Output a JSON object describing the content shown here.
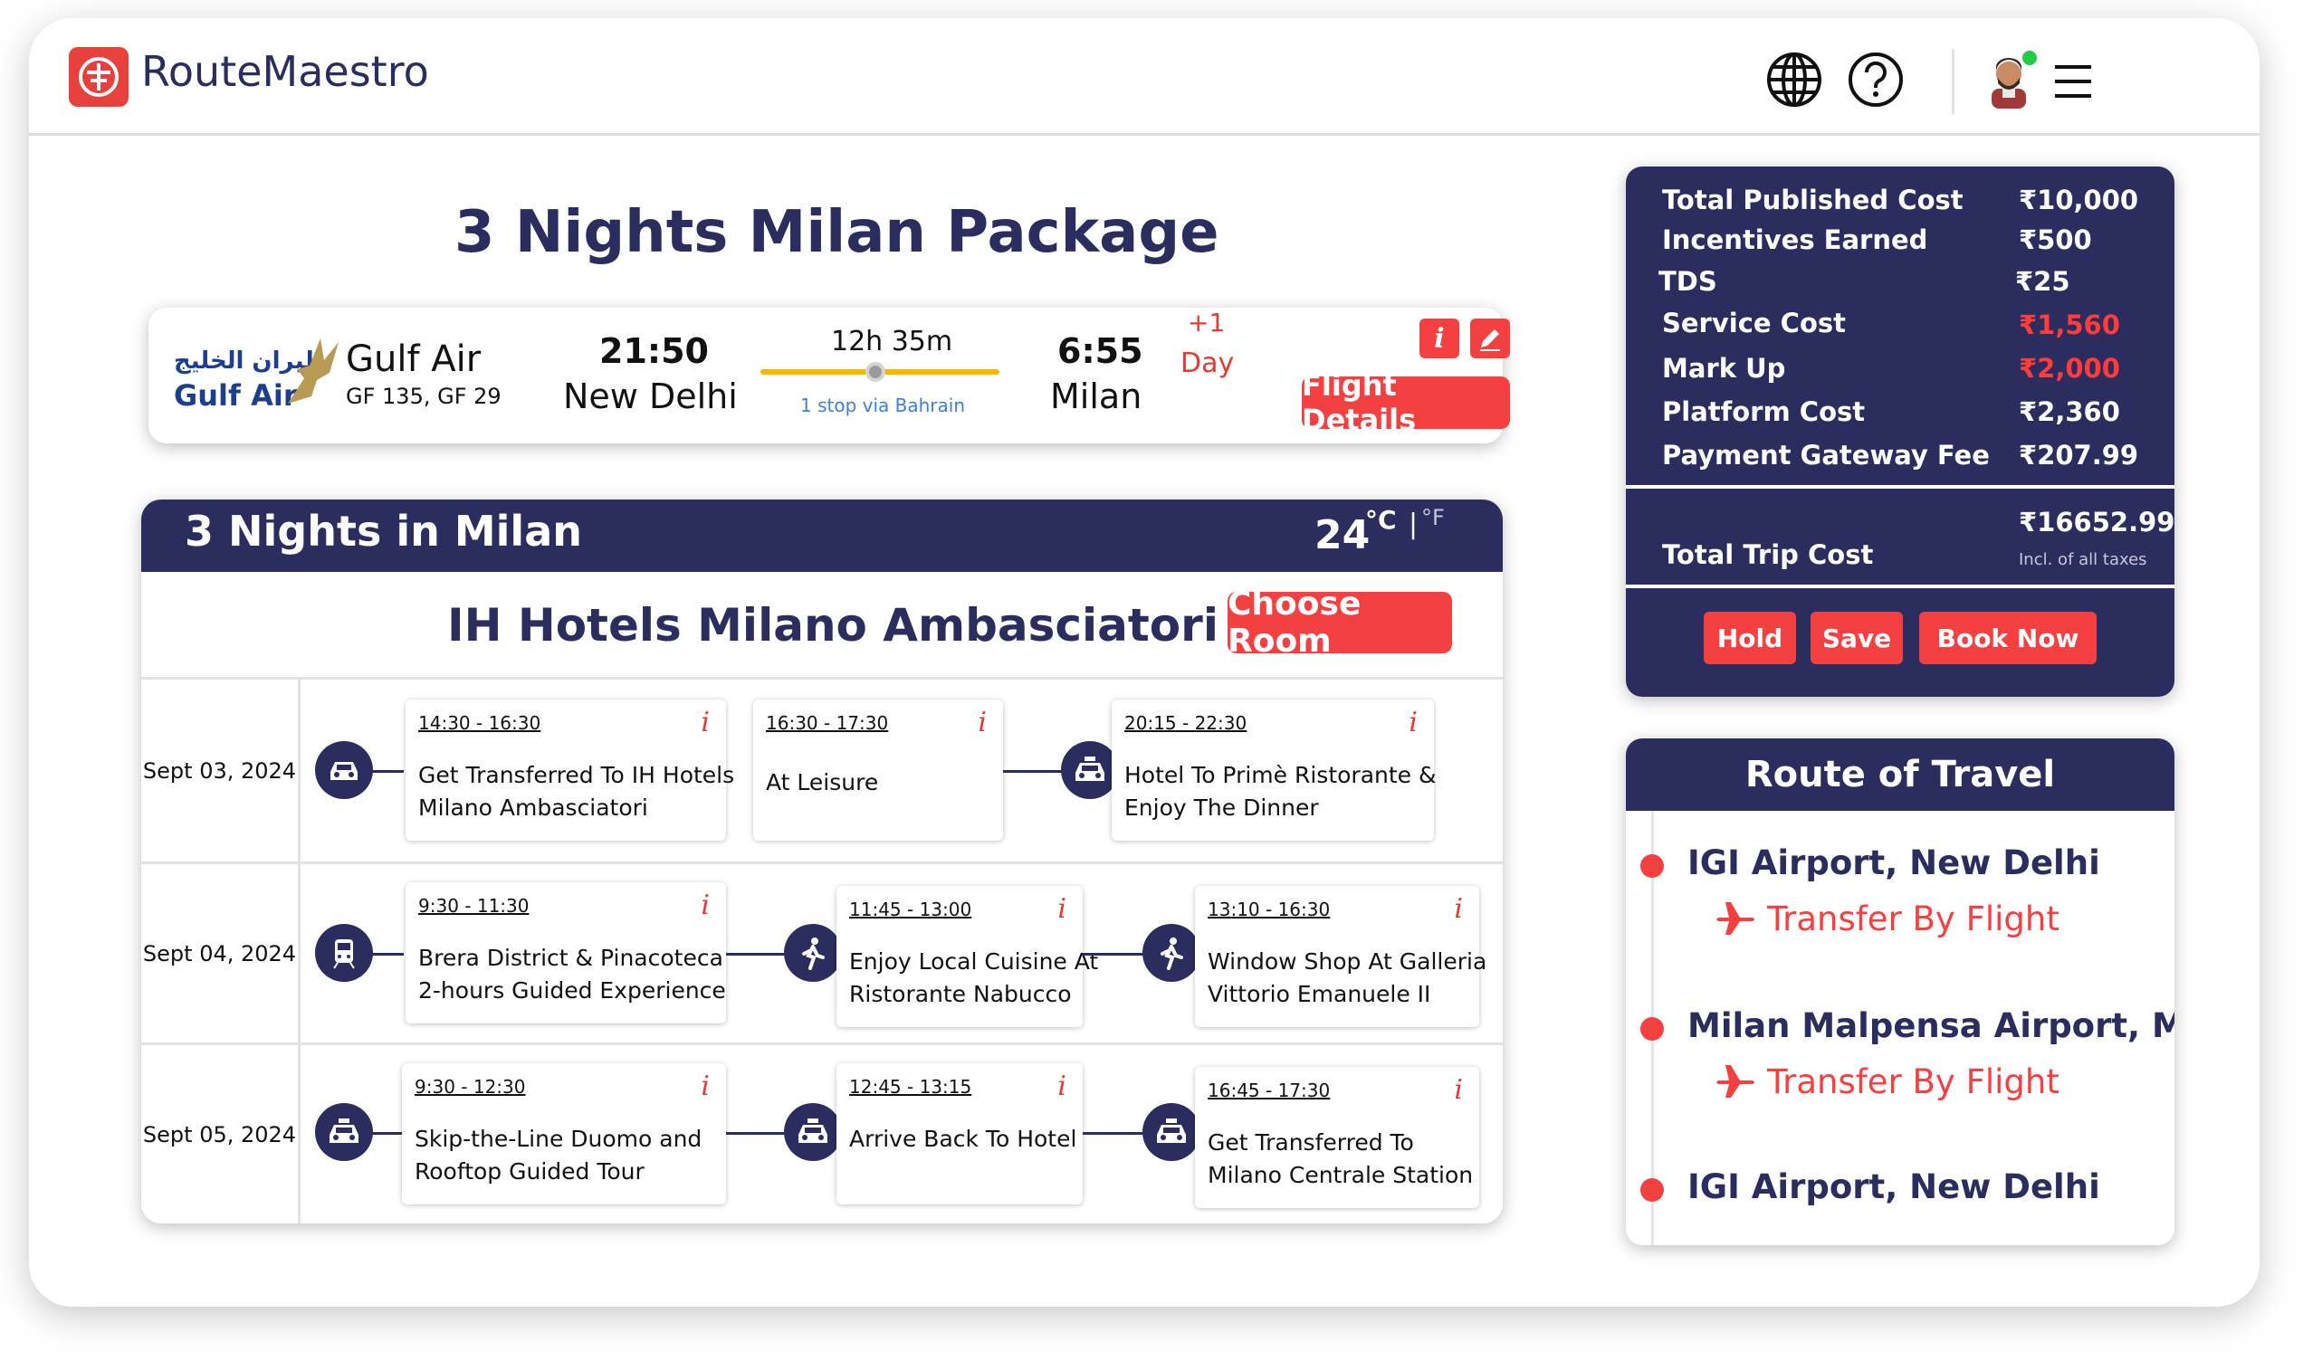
{
  "app": {
    "name": "RouteMaestro"
  },
  "header": {
    "icons": [
      "globe-icon",
      "help-icon",
      "avatar",
      "menu-icon"
    ]
  },
  "page_title": "3 Nights Milan Package",
  "flight": {
    "airline_arabic": "طيران الخليج",
    "airline_logo_text": "Gulf Air",
    "airline_name": "Gulf Air",
    "flight_numbers": "GF 135, GF 29",
    "depart_time": "21:50",
    "depart_city": "New Delhi",
    "duration": "12h 35m",
    "stops": "1 stop via Bahrain",
    "arrive_time": "6:55",
    "arrive_city": "Milan",
    "day_offset": "+1",
    "day_label": "Day",
    "info_label": "i",
    "details_label": "Flight Details"
  },
  "stay": {
    "title": "3 Nights in Milan",
    "temp": "24",
    "unit_c": "°C",
    "sep": "|",
    "unit_f": "°F",
    "hotel": "IH Hotels Milano Ambasciatori",
    "choose_room": "Choose Room"
  },
  "itinerary": [
    {
      "date": "Sept 03, 2024",
      "activities": [
        {
          "time": "14:30 - 16:30",
          "line1": "Get Transferred To IH Hotels",
          "line2": "Milano Ambasciatori"
        },
        {
          "time": "16:30 - 17:30",
          "line1": "At Leisure",
          "line2": ""
        },
        {
          "time": "20:15 - 22:30",
          "line1": "Hotel To Primè Ristorante &",
          "line2": "Enjoy The Dinner"
        }
      ]
    },
    {
      "date": "Sept 04, 2024",
      "activities": [
        {
          "time": "9:30 - 11:30",
          "line1": "Brera District & Pinacoteca",
          "line2": "2-hours Guided Experience"
        },
        {
          "time": "11:45 - 13:00",
          "line1": "Enjoy Local Cuisine At",
          "line2": "Ristorante Nabucco"
        },
        {
          "time": "13:10 - 16:30",
          "line1": "Window Shop At Galleria",
          "line2": "Vittorio Emanuele II"
        }
      ]
    },
    {
      "date": "Sept 05, 2024",
      "activities": [
        {
          "time": "9:30 - 12:30",
          "line1": "Skip-the-Line Duomo and",
          "line2": "Rooftop Guided Tour"
        },
        {
          "time": "12:45 - 13:15",
          "line1": "Arrive Back To Hotel",
          "line2": ""
        },
        {
          "time": "16:45 - 17:30",
          "line1": "Get Transferred To",
          "line2": "Milano Centrale Station"
        }
      ]
    }
  ],
  "info_glyph": "i",
  "costs": {
    "rows": [
      {
        "label": "Total Published Cost",
        "value": "₹10,000",
        "color": "#ffffff"
      },
      {
        "label": "Incentives Earned",
        "value": "₹500",
        "color": "#ffffff"
      },
      {
        "label": "TDS",
        "value": "₹25",
        "color": "#ffffff"
      },
      {
        "label": "Service Cost",
        "value": "₹1,560",
        "color": "#ff3b3b"
      },
      {
        "label": "Mark Up",
        "value": "₹2,000",
        "color": "#ff3b3b"
      },
      {
        "label": "Platform Cost",
        "value": "₹2,360",
        "color": "#ffffff"
      },
      {
        "label": "Payment Gateway Fee",
        "value": "₹207.99",
        "color": "#ffffff"
      }
    ],
    "total_label": "Total Trip Cost",
    "total_value": "₹16652.99",
    "total_note": "Incl. of all taxes",
    "hold": "Hold",
    "save": "Save",
    "book": "Book Now"
  },
  "route": {
    "title": "Route of Travel",
    "stop1": "IGI Airport, New Delhi",
    "transfer1": "Transfer By Flight",
    "stop2": "Milan Malpensa Airport, Milan",
    "transfer2": "Transfer By Flight",
    "stop3": "IGI Airport, New Delhi"
  },
  "colors": {
    "navy": "#2b2d5e",
    "accent": "#f44040"
  }
}
